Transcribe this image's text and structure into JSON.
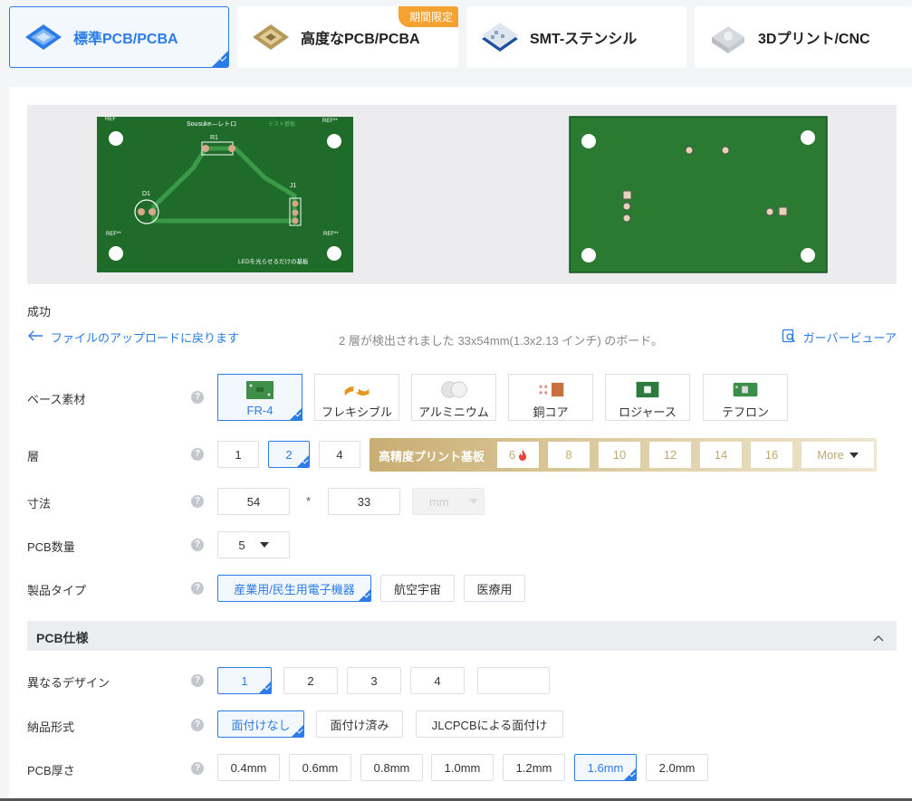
{
  "tabs": [
    {
      "label": "標準PCB/PCBA",
      "active": true
    },
    {
      "label": "高度なPCB/PCBA",
      "badge": "期間限定"
    },
    {
      "label": "SMT-ステンシル"
    },
    {
      "label": "3Dプリント/CNC"
    }
  ],
  "preview": {
    "front": {
      "title": "Sousuke—レトロ",
      "tag": "テスト基板",
      "r1": "R1",
      "d1": "D1",
      "j1": "J1",
      "ref_bl": "REF**",
      "ref_tr": "REF**",
      "ref_br": "REF**",
      "ref_tl": "REF",
      "footer": "LEDを光らせるだけの基板"
    }
  },
  "status": "成功",
  "back_link": "ファイルのアップロードに戻ります",
  "detected": "2 層が検出されました 33x54mm(1.3x2.13 インチ) のボード。",
  "gerber_viewer": "ガーバービューア",
  "colors": {
    "accent": "#2b7ce9",
    "pcb_green": "#1e6b2a",
    "gold": "#c9ad72"
  },
  "form": {
    "base_material": {
      "label": "ベース素材",
      "options": [
        "FR-4",
        "フレキシブル",
        "アルミニウム",
        "銅コア",
        "ロジャース",
        "テフロン"
      ],
      "selected": "FR-4"
    },
    "layers": {
      "label": "層",
      "options": [
        "1",
        "2",
        "4"
      ],
      "selected": "2",
      "high_precision_label": "高精度プリント基板",
      "high_options": [
        "6",
        "8",
        "10",
        "12",
        "14",
        "16"
      ],
      "more": "More"
    },
    "dimensions": {
      "label": "寸法",
      "width": "54",
      "sep": "*",
      "height": "33",
      "unit": "mm"
    },
    "quantity": {
      "label": "PCB数量",
      "value": "5"
    },
    "product_type": {
      "label": "製品タイプ",
      "options": [
        "産業用/民生用電子機器",
        "航空宇宙",
        "医療用"
      ],
      "selected": "産業用/民生用電子機器"
    },
    "section_title": "PCB仕様",
    "designs": {
      "label": "異なるデザイン",
      "options": [
        "1",
        "2",
        "3",
        "4",
        ""
      ],
      "selected": "1"
    },
    "delivery": {
      "label": "納品形式",
      "options": [
        "面付けなし",
        "面付け済み",
        "JLCPCBによる面付け"
      ],
      "selected": "面付けなし"
    },
    "thickness": {
      "label": "PCB厚さ",
      "options": [
        "0.4mm",
        "0.6mm",
        "0.8mm",
        "1.0mm",
        "1.2mm",
        "1.6mm",
        "2.0mm"
      ],
      "selected": "1.6mm"
    }
  },
  "help_glyph": "?"
}
